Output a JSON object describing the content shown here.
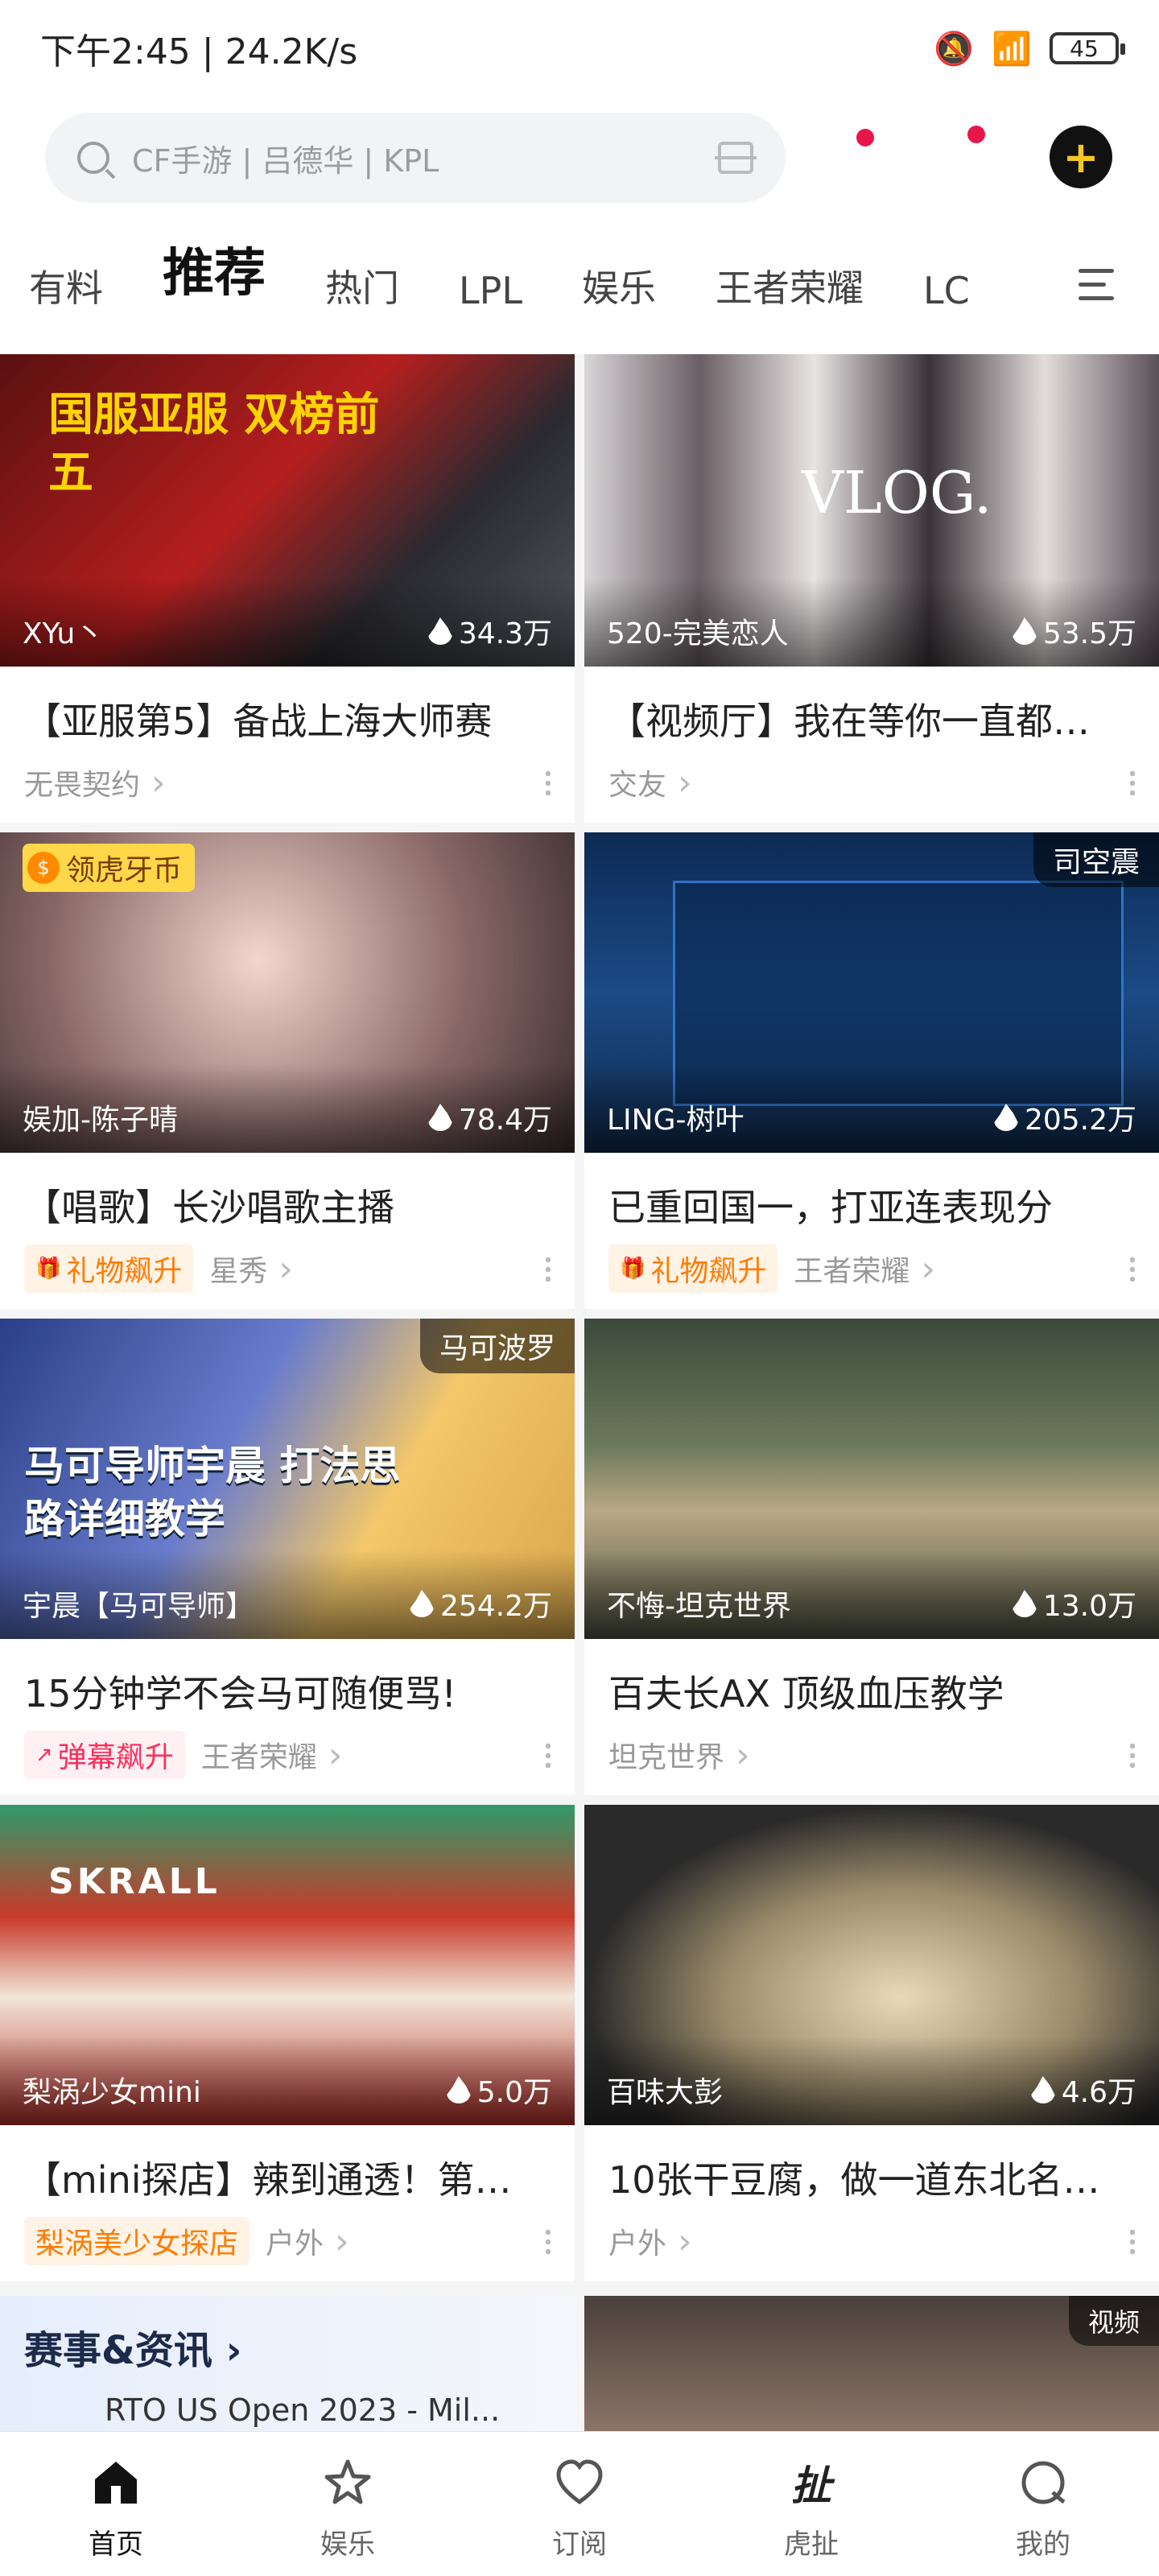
{
  "status": {
    "time": "下午2:45 | 24.2K/s",
    "battery": "45"
  },
  "search": {
    "placeholder": "CF手游 | 吕德华 | KPL"
  },
  "tabs": [
    "有料",
    "推荐",
    "热门",
    "LPL",
    "娱乐",
    "王者荣耀",
    "LC"
  ],
  "cards": [
    {
      "streamer": "XYu丶",
      "views": "34.3万",
      "title": "【亚服第5】备战上海大师赛",
      "category": "无畏契约",
      "thumb_text": "国服亚服 双榜前五"
    },
    {
      "streamer": "520-完美恋人",
      "views": "53.5万",
      "title": "【视频厅】我在等你一直都…",
      "category": "交友",
      "thumb_text": "VLOG."
    },
    {
      "streamer": "娱加-陈子晴",
      "views": "78.4万",
      "title": "【唱歌】长沙唱歌主播",
      "tag": "礼物飙升",
      "category": "星秀",
      "badge": "领虎牙币"
    },
    {
      "streamer": "LING-树叶",
      "views": "205.2万",
      "title": "已重回国一，打亚连表现分",
      "tag": "礼物飙升",
      "category": "王者荣耀",
      "corner": "司空震"
    },
    {
      "streamer": "宇晨【马可导师】",
      "views": "254.2万",
      "title": "15分钟学不会马可随便骂!",
      "tag": "弹幕飙升",
      "category": "王者荣耀",
      "corner": "马可波罗",
      "thumb_text": "马可导师宇晨 打法思路详细教学"
    },
    {
      "streamer": "不悔-坦克世界",
      "views": "13.0万",
      "title": "百夫长AX 顶级血压教学",
      "category": "坦克世界"
    },
    {
      "streamer": "梨涡少女mini",
      "views": "5.0万",
      "title": "【mini探店】辣到通透！第…",
      "tag": "梨涡美少女探店",
      "category": "户外",
      "thumb_text": "SKRALL"
    },
    {
      "streamer": "百味大彭",
      "views": "4.6万",
      "title": "10张干豆腐，做一道东北名…",
      "category": "户外"
    }
  ],
  "news": {
    "heading": "赛事&资讯",
    "item": "RTO US Open 2023 - Mil..."
  },
  "video_corner": "视频",
  "nav": [
    "首页",
    "娱乐",
    "订阅",
    "虎扯",
    "我的"
  ]
}
